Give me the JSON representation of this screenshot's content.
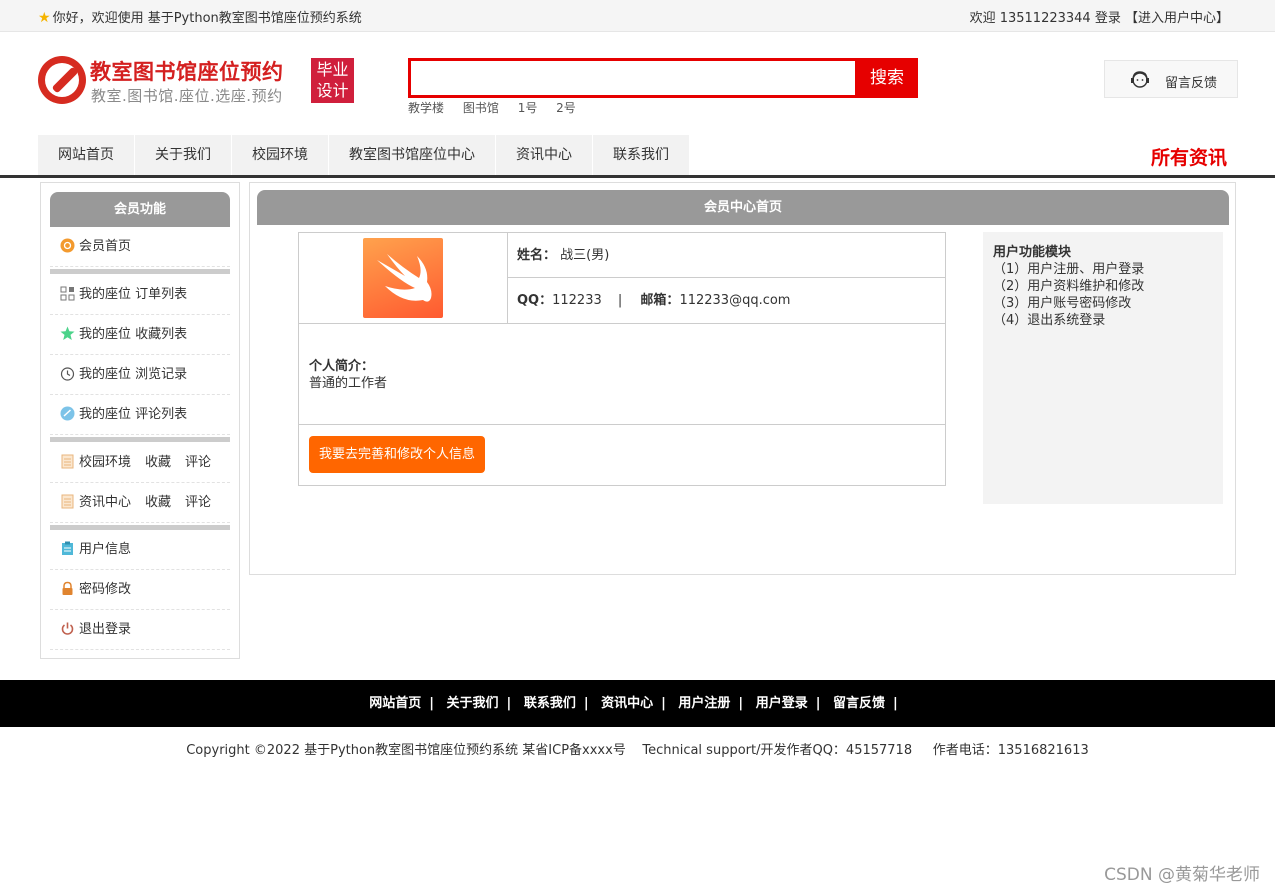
{
  "topbar": {
    "welcome": "你好，欢迎使用 基于Python教室图书馆座位预约系统",
    "user_text": "欢迎 13511223344 登录",
    "user_center": "【进入用户中心】"
  },
  "header": {
    "title": "教室图书馆座位预约",
    "subtitle": "教室.图书馆.座位.选座.预约",
    "badge": "毕业设计",
    "search_button": "搜索",
    "search_placeholder": "",
    "hot_words": [
      "教学楼",
      "图书馆",
      "1号",
      "2号"
    ],
    "feedback": "留言反馈"
  },
  "nav": {
    "items": [
      "网站首页",
      "关于我们",
      "校园环境",
      "教室图书馆座位中心",
      "资讯中心",
      "联系我们"
    ],
    "right_label": "所有资讯"
  },
  "sidebar": {
    "title": "会员功能",
    "home": "会员首页",
    "seat_orders": "我的座位 订单列表",
    "seat_favorites": "我的座位 收藏列表",
    "seat_history": "我的座位 浏览记录",
    "seat_comments": "我的座位 评论列表",
    "campus": "校园环境",
    "campus_fav": "收藏",
    "campus_comment": "评论",
    "news": "资讯中心",
    "news_fav": "收藏",
    "news_comment": "评论",
    "user_info": "用户信息",
    "password": "密码修改",
    "logout": "退出登录"
  },
  "main": {
    "title": "会员中心首页",
    "name_label": "姓名：",
    "name_value": "战三(男)",
    "qq_label": "QQ：",
    "qq_value": "112233",
    "separator": "|",
    "email_label": "邮箱：",
    "email_value": "112233@qq.com",
    "intro_label": "个人简介：",
    "intro_value": "普通的工作者",
    "edit_button": "我要去完善和修改个人信息",
    "func_title": "用户功能模块",
    "func_items": [
      "（1）用户注册、用户登录",
      "（2）用户资料维护和修改",
      "（3）用户账号密码修改",
      "（4）退出系统登录"
    ]
  },
  "footer": {
    "links": [
      "网站首页",
      "关于我们",
      "联系我们",
      "资讯中心",
      "用户注册",
      "用户登录",
      "留言反馈"
    ],
    "copyright": "Copyright ©2022 基于Python教室图书馆座位预约系统 某省ICP备xxxx号    Technical support/开发作者QQ：45157718     作者电话：13516821613",
    "watermark": "CSDN @黄菊华老师"
  },
  "colors": {
    "accent_red": "#e60000",
    "brand_red": "#d42020",
    "orange": "#ff6600",
    "header_gray": "#999999"
  }
}
